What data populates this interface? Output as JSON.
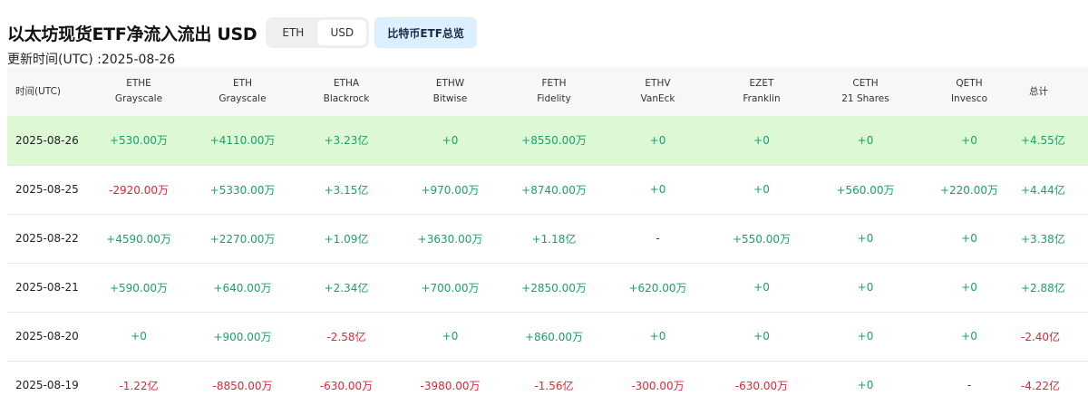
{
  "header": {
    "title": "以太坊现货ETF净流入流出 USD",
    "toggle": [
      "ETH",
      "USD"
    ],
    "active_toggle": "USD",
    "btc_button": "比特币ETF总览"
  },
  "subtitle": "更新时间(UTC) :2025-08-26",
  "colors": {
    "positive": "#1aa16b",
    "negative": "#e5243a",
    "highlight": "#dcf8d4",
    "button": "#dcefff"
  },
  "table": {
    "columns": [
      {
        "ticker": "时间(UTC)",
        "issuer": ""
      },
      {
        "ticker": "ETHE",
        "issuer": "Grayscale"
      },
      {
        "ticker": "ETH",
        "issuer": "Grayscale"
      },
      {
        "ticker": "ETHA",
        "issuer": "Blackrock"
      },
      {
        "ticker": "ETHW",
        "issuer": "Bitwise"
      },
      {
        "ticker": "FETH",
        "issuer": "Fidelity"
      },
      {
        "ticker": "ETHV",
        "issuer": "VanEck"
      },
      {
        "ticker": "EZET",
        "issuer": "Franklin"
      },
      {
        "ticker": "CETH",
        "issuer": "21 Shares"
      },
      {
        "ticker": "QETH",
        "issuer": "Invesco"
      },
      {
        "ticker": "总计",
        "issuer": ""
      }
    ],
    "rows": [
      {
        "date": "2025-08-26",
        "highlight": true,
        "cells": [
          "+530.00万",
          "+4110.00万",
          "+3.23亿",
          "+0",
          "+8550.00万",
          "+0",
          "+0",
          "+0",
          "+0",
          "+4.55亿"
        ]
      },
      {
        "date": "2025-08-25",
        "highlight": false,
        "cells": [
          "-2920.00万",
          "+5330.00万",
          "+3.15亿",
          "+970.00万",
          "+8740.00万",
          "+0",
          "+0",
          "+560.00万",
          "+220.00万",
          "+4.44亿"
        ]
      },
      {
        "date": "2025-08-22",
        "highlight": false,
        "cells": [
          "+4590.00万",
          "+2270.00万",
          "+1.09亿",
          "+3630.00万",
          "+1.18亿",
          "-",
          "+550.00万",
          "+0",
          "+0",
          "+3.38亿"
        ]
      },
      {
        "date": "2025-08-21",
        "highlight": false,
        "cells": [
          "+590.00万",
          "+640.00万",
          "+2.34亿",
          "+700.00万",
          "+2850.00万",
          "+620.00万",
          "+0",
          "+0",
          "+0",
          "+2.88亿"
        ]
      },
      {
        "date": "2025-08-20",
        "highlight": false,
        "cells": [
          "+0",
          "+900.00万",
          "-2.58亿",
          "+0",
          "+860.00万",
          "+0",
          "+0",
          "+0",
          "+0",
          "-2.40亿"
        ]
      },
      {
        "date": "2025-08-19",
        "highlight": false,
        "cells": [
          "-1.22亿",
          "-8850.00万",
          "-630.00万",
          "-3980.00万",
          "-1.56亿",
          "-300.00万",
          "-630.00万",
          "+0",
          "-",
          "-4.22亿"
        ]
      }
    ]
  }
}
